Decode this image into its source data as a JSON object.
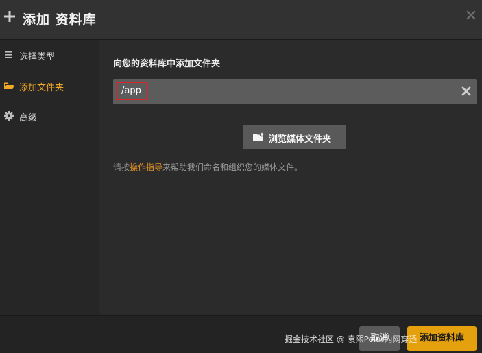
{
  "dialog": {
    "title": "添加 资料库",
    "plus_icon": "plus-icon",
    "close_icon": "close-icon"
  },
  "sidebar": {
    "items": [
      {
        "label": "选择类型",
        "icon": "list-icon",
        "active": false
      },
      {
        "label": "添加文件夹",
        "icon": "folder-open-icon",
        "active": true
      },
      {
        "label": "高级",
        "icon": "gear-icon",
        "active": false
      }
    ]
  },
  "content": {
    "section_title": "向您的资料库中添加文件夹",
    "path_value": "/app",
    "clear_icon": "clear-icon",
    "browse_label": "浏览媒体文件夹",
    "browse_icon": "folder-add-icon",
    "help_prefix": "请按",
    "help_link": "操作指导",
    "help_suffix": "来帮助我们命名和组织您的媒体文件。"
  },
  "footer": {
    "cancel_label": "取消",
    "next_label": "添加资料库",
    "watermark": "掘金技术社区 @ 袁熙Polar内网穿透"
  },
  "colors": {
    "accent": "#e5a00d",
    "link": "#e0922a",
    "highlight_border": "#d6262a"
  }
}
